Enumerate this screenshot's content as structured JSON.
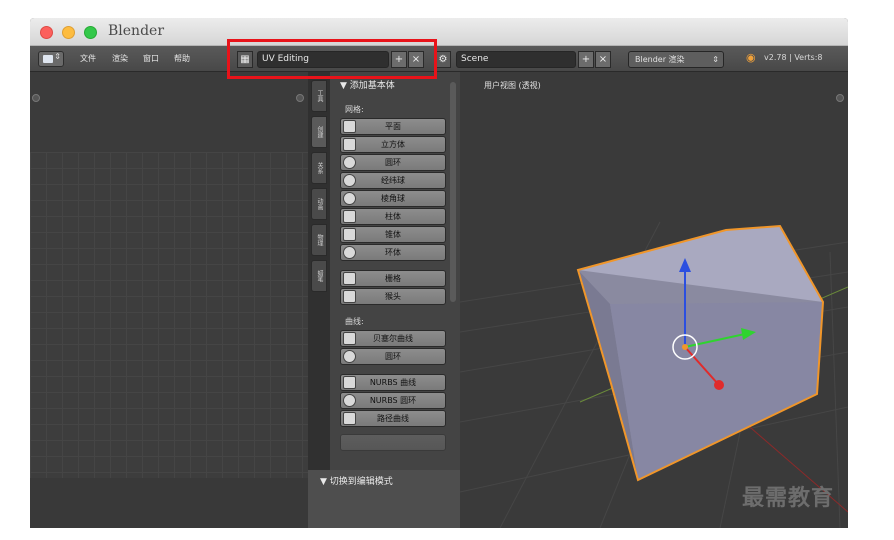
{
  "window": {
    "title": "Blender"
  },
  "infobar": {
    "menus": [
      "文件",
      "渲染",
      "窗口",
      "帮助"
    ],
    "screen_layout": "UV Editing",
    "scene": "Scene",
    "render_engine": "Blender 渲染",
    "version_info": "v2.78 | Verts:8"
  },
  "toolshelf": {
    "tabs": [
      "工具",
      "创建",
      "关系",
      "动画",
      "物理",
      "蜡笔"
    ],
    "panel_title": "▼ 添加基本体",
    "mesh_section": "网格:",
    "mesh_buttons": [
      "平面",
      "立方体",
      "圆环",
      "经纬球",
      "棱角球",
      "柱体",
      "锥体",
      "环体",
      "栅格",
      "猴头"
    ],
    "curve_section": "曲线:",
    "curve_buttons": [
      "贝塞尔曲线",
      "圆环",
      "NURBS 曲线",
      "NURBS 圆环",
      "路径曲线"
    ],
    "bottom_panel": "▼ 切换到编辑模式"
  },
  "viewport": {
    "label": "用户视图 (透视)"
  },
  "colors": {
    "highlight": "#e8131a",
    "selection_outline": "#f0962a",
    "cube_face": "#8f8fa6"
  },
  "watermark": "最需教育"
}
